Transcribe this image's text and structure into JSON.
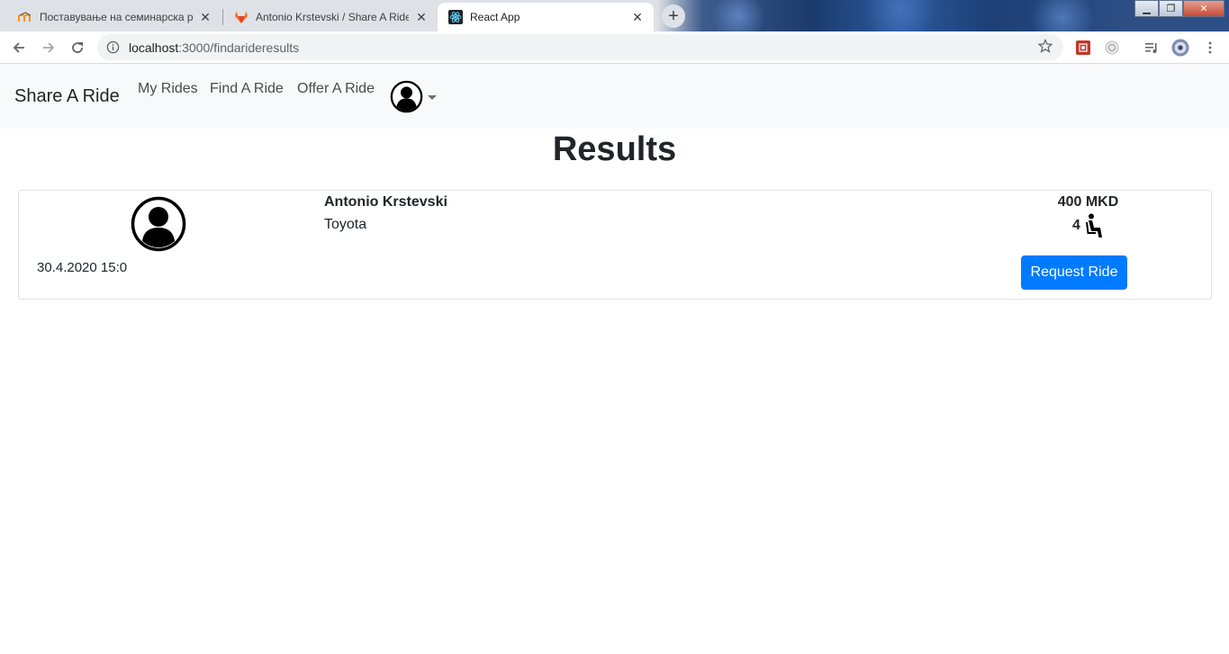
{
  "browser": {
    "tabs": [
      {
        "title": "Поставување на семинарска ра",
        "icon": "moodle-icon",
        "active": false
      },
      {
        "title": "Antonio Krstevski / Share A Ride",
        "icon": "gitlab-icon",
        "active": false
      },
      {
        "title": "React App",
        "icon": "react-icon",
        "active": true
      }
    ],
    "url_host": "localhost",
    "url_rest": ":3000/findarideresults"
  },
  "navbar": {
    "brand": "Share A Ride",
    "links": [
      "My Rides",
      "Find A Ride",
      "Offer A Ride"
    ]
  },
  "main": {
    "title": "Results",
    "results": [
      {
        "driver": "Antonio Krstevski",
        "car": "Toyota",
        "date": "30.4.2020 15:0",
        "price": "400 MKD",
        "seats": "4",
        "action_label": "Request Ride"
      }
    ]
  },
  "colors": {
    "accent": "#007bff",
    "navbar_bg": "#f8f9fa",
    "text": "#212529"
  }
}
